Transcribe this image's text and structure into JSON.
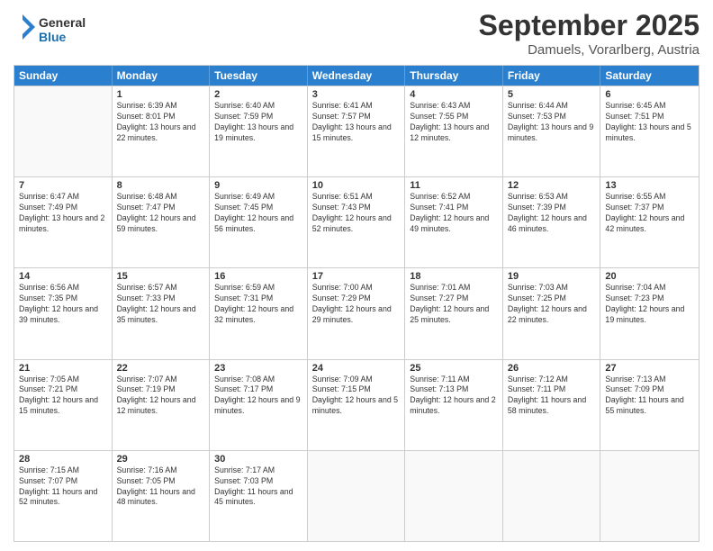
{
  "header": {
    "logo_line1": "General",
    "logo_line2": "Blue",
    "month": "September 2025",
    "location": "Damuels, Vorarlberg, Austria"
  },
  "days_of_week": [
    "Sunday",
    "Monday",
    "Tuesday",
    "Wednesday",
    "Thursday",
    "Friday",
    "Saturday"
  ],
  "weeks": [
    [
      {
        "day": "",
        "info": ""
      },
      {
        "day": "1",
        "info": "Sunrise: 6:39 AM\nSunset: 8:01 PM\nDaylight: 13 hours\nand 22 minutes."
      },
      {
        "day": "2",
        "info": "Sunrise: 6:40 AM\nSunset: 7:59 PM\nDaylight: 13 hours\nand 19 minutes."
      },
      {
        "day": "3",
        "info": "Sunrise: 6:41 AM\nSunset: 7:57 PM\nDaylight: 13 hours\nand 15 minutes."
      },
      {
        "day": "4",
        "info": "Sunrise: 6:43 AM\nSunset: 7:55 PM\nDaylight: 13 hours\nand 12 minutes."
      },
      {
        "day": "5",
        "info": "Sunrise: 6:44 AM\nSunset: 7:53 PM\nDaylight: 13 hours\nand 9 minutes."
      },
      {
        "day": "6",
        "info": "Sunrise: 6:45 AM\nSunset: 7:51 PM\nDaylight: 13 hours\nand 5 minutes."
      }
    ],
    [
      {
        "day": "7",
        "info": "Sunrise: 6:47 AM\nSunset: 7:49 PM\nDaylight: 13 hours\nand 2 minutes."
      },
      {
        "day": "8",
        "info": "Sunrise: 6:48 AM\nSunset: 7:47 PM\nDaylight: 12 hours\nand 59 minutes."
      },
      {
        "day": "9",
        "info": "Sunrise: 6:49 AM\nSunset: 7:45 PM\nDaylight: 12 hours\nand 56 minutes."
      },
      {
        "day": "10",
        "info": "Sunrise: 6:51 AM\nSunset: 7:43 PM\nDaylight: 12 hours\nand 52 minutes."
      },
      {
        "day": "11",
        "info": "Sunrise: 6:52 AM\nSunset: 7:41 PM\nDaylight: 12 hours\nand 49 minutes."
      },
      {
        "day": "12",
        "info": "Sunrise: 6:53 AM\nSunset: 7:39 PM\nDaylight: 12 hours\nand 46 minutes."
      },
      {
        "day": "13",
        "info": "Sunrise: 6:55 AM\nSunset: 7:37 PM\nDaylight: 12 hours\nand 42 minutes."
      }
    ],
    [
      {
        "day": "14",
        "info": "Sunrise: 6:56 AM\nSunset: 7:35 PM\nDaylight: 12 hours\nand 39 minutes."
      },
      {
        "day": "15",
        "info": "Sunrise: 6:57 AM\nSunset: 7:33 PM\nDaylight: 12 hours\nand 35 minutes."
      },
      {
        "day": "16",
        "info": "Sunrise: 6:59 AM\nSunset: 7:31 PM\nDaylight: 12 hours\nand 32 minutes."
      },
      {
        "day": "17",
        "info": "Sunrise: 7:00 AM\nSunset: 7:29 PM\nDaylight: 12 hours\nand 29 minutes."
      },
      {
        "day": "18",
        "info": "Sunrise: 7:01 AM\nSunset: 7:27 PM\nDaylight: 12 hours\nand 25 minutes."
      },
      {
        "day": "19",
        "info": "Sunrise: 7:03 AM\nSunset: 7:25 PM\nDaylight: 12 hours\nand 22 minutes."
      },
      {
        "day": "20",
        "info": "Sunrise: 7:04 AM\nSunset: 7:23 PM\nDaylight: 12 hours\nand 19 minutes."
      }
    ],
    [
      {
        "day": "21",
        "info": "Sunrise: 7:05 AM\nSunset: 7:21 PM\nDaylight: 12 hours\nand 15 minutes."
      },
      {
        "day": "22",
        "info": "Sunrise: 7:07 AM\nSunset: 7:19 PM\nDaylight: 12 hours\nand 12 minutes."
      },
      {
        "day": "23",
        "info": "Sunrise: 7:08 AM\nSunset: 7:17 PM\nDaylight: 12 hours\nand 9 minutes."
      },
      {
        "day": "24",
        "info": "Sunrise: 7:09 AM\nSunset: 7:15 PM\nDaylight: 12 hours\nand 5 minutes."
      },
      {
        "day": "25",
        "info": "Sunrise: 7:11 AM\nSunset: 7:13 PM\nDaylight: 12 hours\nand 2 minutes."
      },
      {
        "day": "26",
        "info": "Sunrise: 7:12 AM\nSunset: 7:11 PM\nDaylight: 11 hours\nand 58 minutes."
      },
      {
        "day": "27",
        "info": "Sunrise: 7:13 AM\nSunset: 7:09 PM\nDaylight: 11 hours\nand 55 minutes."
      }
    ],
    [
      {
        "day": "28",
        "info": "Sunrise: 7:15 AM\nSunset: 7:07 PM\nDaylight: 11 hours\nand 52 minutes."
      },
      {
        "day": "29",
        "info": "Sunrise: 7:16 AM\nSunset: 7:05 PM\nDaylight: 11 hours\nand 48 minutes."
      },
      {
        "day": "30",
        "info": "Sunrise: 7:17 AM\nSunset: 7:03 PM\nDaylight: 11 hours\nand 45 minutes."
      },
      {
        "day": "",
        "info": ""
      },
      {
        "day": "",
        "info": ""
      },
      {
        "day": "",
        "info": ""
      },
      {
        "day": "",
        "info": ""
      }
    ]
  ]
}
